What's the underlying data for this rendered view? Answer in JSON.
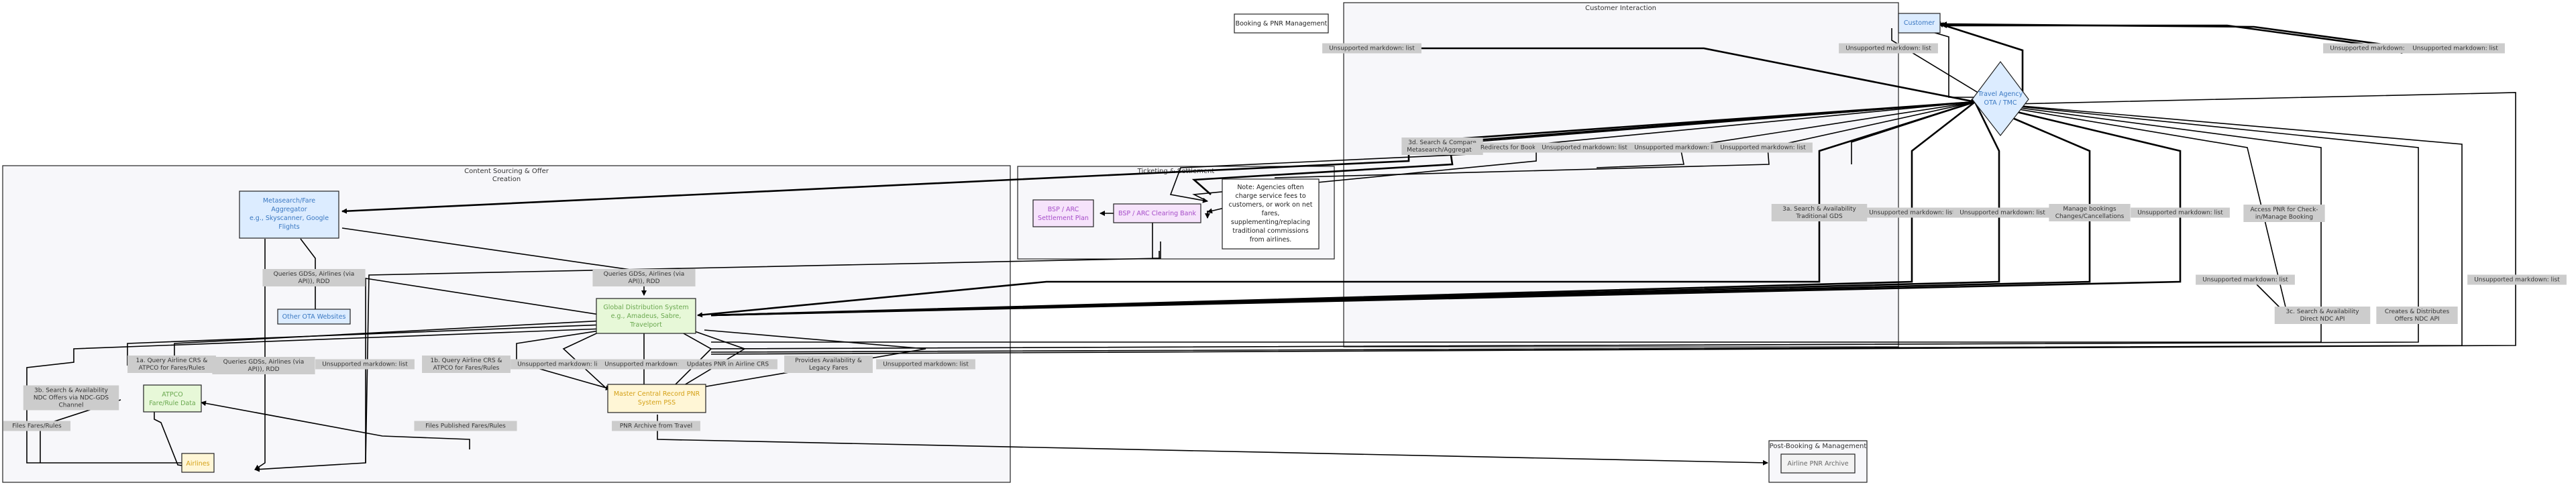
{
  "title_box": "Booking & PNR Management",
  "groups": {
    "customer": "Customer Interaction",
    "content_line1": "Content Sourcing & Offer",
    "content_line2": "Creation",
    "ticketing": "Ticketing & Settlement",
    "postbooking": "Post-Booking & Management"
  },
  "nodes": {
    "customer": [
      "Customer"
    ],
    "travel_agency": [
      "Travel Agency",
      "OTA / TMC"
    ],
    "metasearch": [
      "Metasearch/Fare",
      "Aggregator",
      "e.g., Skyscanner, Google",
      "Flights"
    ],
    "other_ota": [
      "Other OTA Websites"
    ],
    "gds": [
      "Global Distribution System",
      "e.g., Amadeus, Sabre,",
      "Travelport"
    ],
    "atpco": [
      "ATPCO",
      "Fare/Rule Data"
    ],
    "airlines": [
      "Airlines"
    ],
    "mpnr": [
      "Master Central Record PNR",
      "System PSS"
    ],
    "bsp": [
      "BSP / ARC",
      "Settlement Plan"
    ],
    "clearing": [
      "BSP / ARC Clearing Bank"
    ],
    "note": [
      "Note: Agencies often",
      "charge service fees to",
      "customers, or work on net",
      "fares,",
      "supplementing/replacing",
      "traditional commissions",
      "from airlines."
    ],
    "airline_pnr": [
      "Airline PNR Archive"
    ]
  },
  "edge_labels": {
    "unsupported": "Unsupported markdown: list",
    "search_compare": [
      "3d. Search & Compare",
      "Metasearch/Aggregator"
    ],
    "redirects": "Redirects for Booking",
    "search_trad": [
      "3a. Search & Availability",
      "Traditional GDS"
    ],
    "manage": [
      "Manage bookings",
      "Changes/Cancellations"
    ],
    "access_pnr": [
      "Access PNR for Check-",
      "in/Manage Booking"
    ],
    "search_direct": [
      "3c. Search & Availability",
      "Direct NDC API"
    ],
    "creates_offers": [
      "Creates & Distributes",
      "Offers NDC API"
    ],
    "queries_gds_1": [
      "Queries GDSs, Airlines (via",
      "API)), RDD"
    ],
    "queries_gds_2": [
      "Queries GDSs, Airlines (via",
      "API)), RDD"
    ],
    "queries_gds_3": [
      "Queries GDSs, Airlines (via",
      "API)), RDD"
    ],
    "query_atpco_1": [
      "1a. Query Airline CRS &",
      "ATPCO for Fares/Rules"
    ],
    "query_atpco_2": [
      "1b. Query Airline CRS &",
      "ATPCO for Fares/Rules"
    ],
    "search_ndc_gds": [
      "3b. Search & Availability",
      "NDC Offers via NDC-GDS",
      "Channel"
    ],
    "files_fares": "Files Fares/Rules",
    "files_published": "Files Published Fares/Rules",
    "updates_pnr": "Updates PNR in Airline CRS",
    "provides": [
      "Provides Availability &",
      "Legacy Fares"
    ],
    "pnr_archive": "PNR Archive from Travel"
  }
}
